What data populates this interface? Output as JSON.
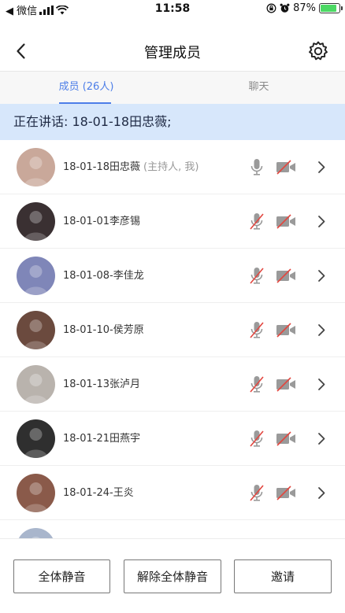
{
  "status_bar": {
    "carrier": "◀ 微信",
    "time": "11:58",
    "battery_percent": "87%"
  },
  "nav": {
    "title": "管理成员"
  },
  "tabs": [
    {
      "label": "成员 (26人)",
      "active": true
    },
    {
      "label": "聊天",
      "active": false
    }
  ],
  "speaking": {
    "text": "正在讲话: 18-01-18田忠薇;"
  },
  "members": [
    {
      "name": "18-01-18田忠薇",
      "role": "(主持人, 我)",
      "mic_muted": false,
      "camera_off": true,
      "avatar_color": "#c9a89a"
    },
    {
      "name": "18-01-01李彦锡",
      "role": "",
      "mic_muted": true,
      "camera_off": true,
      "avatar_color": "#3a3032"
    },
    {
      "name": "18-01-08-李佳龙",
      "role": "",
      "mic_muted": true,
      "camera_off": true,
      "avatar_color": "#7f86b8"
    },
    {
      "name": "18-01-10-侯芳原",
      "role": "",
      "mic_muted": true,
      "camera_off": true,
      "avatar_color": "#6b4a3e"
    },
    {
      "name": "18-01-13张泸月",
      "role": "",
      "mic_muted": true,
      "camera_off": true,
      "avatar_color": "#b9b3ad"
    },
    {
      "name": "18-01-21田燕宇",
      "role": "",
      "mic_muted": true,
      "camera_off": true,
      "avatar_color": "#2f2f2f"
    },
    {
      "name": "18-01-24-王炎",
      "role": "",
      "mic_muted": true,
      "camera_off": true,
      "avatar_color": "#8a5a4a"
    },
    {
      "name": "",
      "role": "",
      "mic_muted": true,
      "camera_off": true,
      "avatar_color": "#a9b6cc"
    }
  ],
  "buttons": {
    "mute_all": "全体静音",
    "unmute_all": "解除全体静音",
    "invite": "邀请"
  },
  "colors": {
    "accent": "#4d7ee8",
    "banner_bg": "#d7e7fb",
    "muted_red": "#e2463f",
    "icon_gray": "#9a9a9a"
  }
}
